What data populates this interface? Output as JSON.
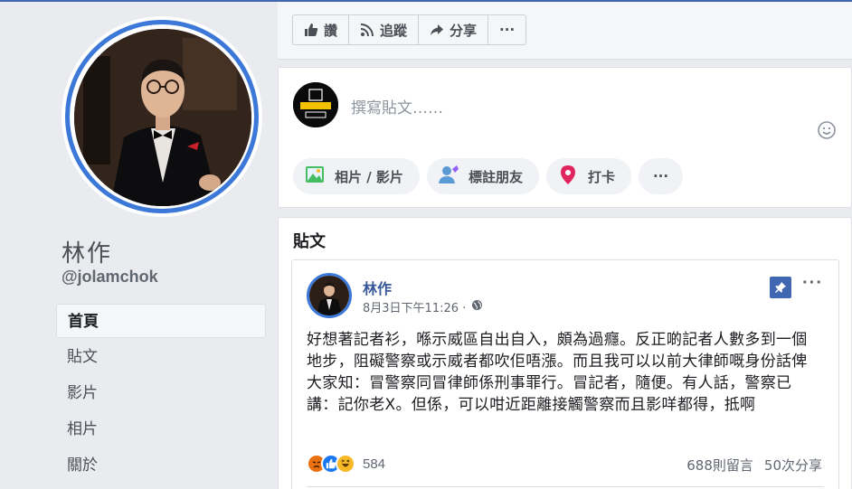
{
  "page": {
    "name": "林作",
    "handle": "@jolamchok"
  },
  "nav": [
    {
      "label": "首頁",
      "active": true
    },
    {
      "label": "貼文",
      "active": false
    },
    {
      "label": "影片",
      "active": false
    },
    {
      "label": "相片",
      "active": false
    },
    {
      "label": "關於",
      "active": false
    }
  ],
  "action_bar": {
    "like": "讚",
    "follow": "追蹤",
    "share": "分享",
    "more": "···"
  },
  "composer": {
    "placeholder": "撰寫貼文……",
    "photo_video": "相片 / 影片",
    "tag_friends": "標註朋友",
    "check_in": "打卡",
    "more": "···"
  },
  "posts_section": {
    "title": "貼文"
  },
  "post": {
    "author": "林作",
    "time": "8月3日下午11:26 ·",
    "text": "好想著記者衫，喺示威區自出自入，頗為過癮。反正啲記者人數多到一個地步，阻礙警察或示威者都吹佢唔漲。而且我可以以前大律師嘅身份話俾大家知：冒警察同冒律師係刑事罪行。冒記者，隨便。有人話，警察已講：記你老X。但係，可以咁近距離接觸警察而且影咩都得，抵啊",
    "reactions_count": "584",
    "comments": "688則留言",
    "shares": "50次分享",
    "more": "···"
  },
  "colors": {
    "brand_blue": "#4267b2",
    "ring_blue": "#3b78d8",
    "link_blue": "#385898"
  }
}
